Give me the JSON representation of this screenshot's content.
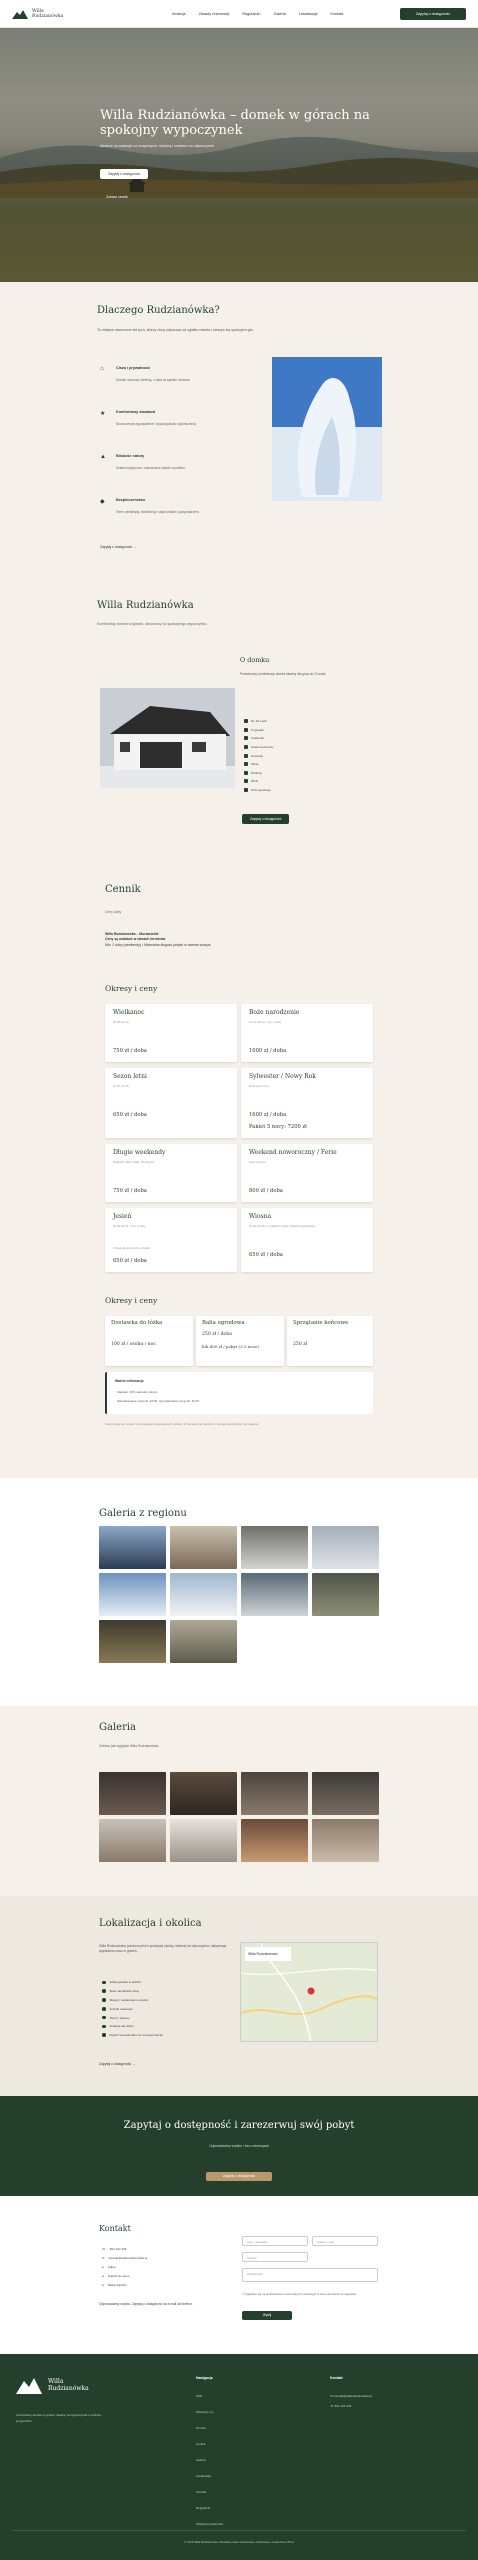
{
  "nav": {
    "brand_line1": "Willa",
    "brand_line2": "Rudzianówka",
    "links": [
      "Atrakcje",
      "Zasady rezerwacji",
      "Regulamin",
      "Galeria",
      "Lokalizacja",
      "Kontakt"
    ],
    "cta": "Zapytaj o dostępność"
  },
  "hero": {
    "title": "Willa Rudzianówka – domek w górach na spokojny wypoczynek",
    "subtitle": "Idealne na wakacje ze znajomymi, rodziną i czasem na odpoczynek",
    "primary": "Zapytaj o dostępność",
    "secondary": "Zobacz cennik"
  },
  "why": {
    "title": "Dlaczego Rudzianówka?",
    "intro": "To miejsce stworzone dla tych, którzy chcą odpocząć od zgiełku miasta i cieszyć się spokojem gór.",
    "features": [
      {
        "icon": "home-icon",
        "title": "Cisza i prywatność",
        "desc": "Domek otoczony zielenią, z dala od zgiełku i tłumów."
      },
      {
        "icon": "star-icon",
        "title": "Komfortowy standard",
        "desc": "Nowoczesne wyposażenie i wysoka jakość wykończenia."
      },
      {
        "icon": "mountain-icon",
        "title": "Bliskość natury",
        "desc": "Szlaki turystyczne i malownicze widoki w pobliżu."
      },
      {
        "icon": "shield-icon",
        "title": "Bezpieczeństwo",
        "desc": "Teren zamknięty, monitoring i stały kontakt z gospodarzem."
      }
    ],
    "more": "Zapytaj o dostępność →"
  },
  "willa": {
    "title": "Willa Rudzianówka",
    "subtitle": "Komfortowy domek w górach, stworzony do spokojnego wypoczynku.",
    "about_title": "O domku",
    "about_text": "Przestronny, komfortowy domek idealny dla grup do 10 osób.",
    "amenities": [
      "Do 10 osób",
      "5 sypialni",
      "3 łazienki",
      "Aneks kuchenny",
      "Kominek",
      "Taras",
      "Parking",
      "Wi-Fi",
      "Grill ogrodowy"
    ],
    "cta": "Zapytaj o dostępność"
  },
  "cennik": {
    "title": "Cennik",
    "lead": "Ceny doby",
    "info_lines": [
      "Willa Rudzianówka – Murzasichle",
      "Ceny są ustalane w ramach terminów",
      "Min. 2 doby (weekendy) • Minimalna długość pobytu w okresie szczytu"
    ],
    "periods_title": "Okresy i ceny",
    "periods": [
      {
        "name": "Wielkanoc",
        "dates": "28.03–01.04",
        "price": "750 zł / doba",
        "extra": ""
      },
      {
        "name": "Boże narodzenie",
        "dates": "22.12–28.12 • min. 4 doby",
        "price": "1000 zł / doba",
        "extra": ""
      },
      {
        "name": "Sezon letni",
        "dates": "01.07–31.08",
        "price": "650 zł / doba",
        "extra": ""
      },
      {
        "name": "Sylwester / Nowy Rok",
        "dates": "Minimum 5 nocy",
        "price": "1600 zł / doba",
        "extra": "Pakiet 5 nocy: 7200 zł"
      },
      {
        "name": "Długie weekendy",
        "dates": "Majówka, Boże Ciało, 15 sierpnia",
        "price": "750 zł / doba",
        "extra": ""
      },
      {
        "name": "Weekend noworoczny / Ferie",
        "dates": "Ferie zimowe",
        "price": "800 zł / doba",
        "extra": ""
      },
      {
        "name": "Jesień",
        "dates": "01.09–30.11 • min. 2 doby",
        "price": "650 zł / doba",
        "extra": "Zniżka dla dłuższych pobytów"
      },
      {
        "name": "Wiosna",
        "dates": "01.04–30.06 (z wyjątkiem świąt i długich weekendów)",
        "price": "650 zł / doba",
        "extra": ""
      }
    ],
    "extras_title": "Okresy i ceny",
    "extras": [
      {
        "name": "Dostawka do łóżka",
        "price": "100 zł / osoba / noc"
      },
      {
        "name": "Balia ogrodowa",
        "price": "250 zł / doba"
      },
      {
        "name": "Sprzątanie końcowe",
        "price": "250 zł"
      }
    ],
    "extra_price_2": "lub 450 zł / pobyt (2-3 noce)",
    "notes_title": "Ważne informacje",
    "notes": [
      "Zadatek: 30% wartości pobytu",
      "Zameldowanie od godz. 16:00, wymeldowanie do godz. 11:00"
    ],
    "footnote": "Ceny mogą się zmienić w przypadku indywidualnych ustaleń. W sprawie cen prosimy o kontakt telefoniczny lub mailowy."
  },
  "gallery_region": {
    "title": "Galeria z regionu"
  },
  "gallery": {
    "title": "Galeria",
    "subtitle": "Zobacz jak wygląda Willa Rudzianówka"
  },
  "lokalizacja": {
    "title": "Lokalizacja i okolica",
    "text": "Willa Rudzianówka położona jest w spokojnej okolicy, idealnej do odpoczynku i aktywnego spędzania czasu w górach.",
    "items": [
      "Szlaki górskie w pobliżu",
      "Stoki narciarskie zimą",
      "Sklepy i restauracje w okolicy",
      "Ścieżki rowerowe",
      "Termy i baseny",
      "Atrakcje dla dzieci",
      "Dojazd samochodem do samego domku"
    ],
    "map_label": "Willa Rudzianówka",
    "more": "Zapytaj o dostępność →"
  },
  "cta": {
    "title": "Zapytaj o dostępność i zarezerwuj swój pobyt",
    "subtitle": "Odpowiadamy szybko i bez zobowiązań",
    "button": "Zapytaj o dostępność"
  },
  "kontakt": {
    "title": "Kontakt",
    "items": [
      "601 222 333",
      "kontakt@willarudzianowka.pl",
      "Adres",
      "Dojazd do domu",
      "Mapa dojazdu"
    ],
    "note": "Odpowiadamy szybko. Zapytaj o dostępność na e-mail lub telefon.",
    "placeholders": [
      "Imię i nazwisko",
      "Adres e-mail",
      "Telefon",
      "Termin pobytu",
      "Wiadomość"
    ],
    "consent": "Zgadzam się na przetwarzanie moich danych osobowych w celu odpowiedzi na zapytanie.",
    "send": "Wyślij"
  },
  "footer": {
    "brand1": "Willa",
    "brand2": "Rudzianówka",
    "desc": "Komfortowy domek w górach, idealny na wypoczynek z rodziną i przyjaciółmi.",
    "nav_title": "Nawigacja",
    "nav_links": [
      "Start",
      "Dlaczego my",
      "Domek",
      "Cennik",
      "Galeria",
      "Lokalizacja",
      "Kontakt",
      "Regulamin",
      "Polityka prywatności"
    ],
    "contact_title": "Kontakt",
    "contact_items": [
      "kontakt@willarudzianowka.pl",
      "601 222 333"
    ],
    "copyright": "© 2025 Willa Rudzianówka. Wszelkie prawa zastrzeżone. Wykonanie: Grupa Neon Pixel"
  },
  "colors": {
    "brand": "#24402c",
    "gold": "#b9996b",
    "cream": "#f5f1ea"
  }
}
